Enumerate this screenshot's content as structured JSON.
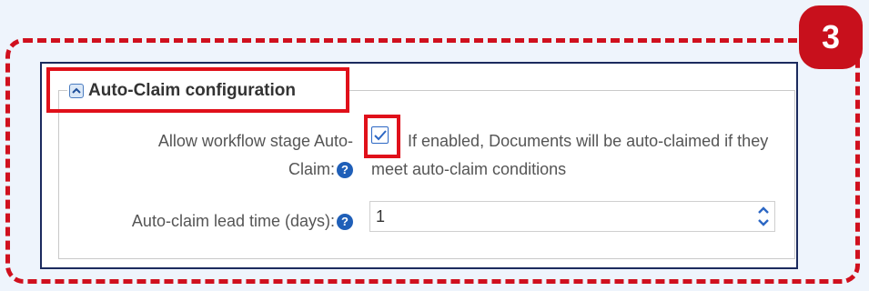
{
  "step_badge": "3",
  "section": {
    "title": "Auto-Claim configuration",
    "collapse_icon": "chevron-up-icon"
  },
  "fields": {
    "allow_autoclaim": {
      "label_line1": "Allow workflow stage Auto-",
      "label_line2": "Claim:",
      "checked": true,
      "description": "If enabled, Documents will be auto-claimed if they meet auto-claim conditions"
    },
    "lead_time": {
      "label": "Auto-claim lead time (days):",
      "value": "1"
    }
  },
  "help_icon_glyph": "?",
  "colors": {
    "annotation_red": "#d0101e",
    "panel_border": "#1b2a5e",
    "accent_blue": "#1f5fb8",
    "background": "#eef4fc"
  }
}
